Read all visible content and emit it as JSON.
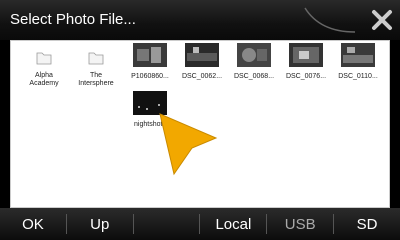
{
  "title": "Select Photo File...",
  "items": [
    {
      "type": "folder",
      "label": "Alpha\nAcademy",
      "icon": "folder-icon"
    },
    {
      "type": "folder",
      "label": "The\nIntersphere",
      "icon": "folder-icon"
    },
    {
      "type": "photo",
      "label": "P1060860..."
    },
    {
      "type": "photo",
      "label": "DSC_0062..."
    },
    {
      "type": "photo",
      "label": "DSC_0068..."
    },
    {
      "type": "photo",
      "label": "DSC_0076..."
    },
    {
      "type": "photo",
      "label": "DSC_0110..."
    },
    {
      "type": "photo",
      "label": "nightshot.j"
    }
  ],
  "buttons": {
    "ok": "OK",
    "up": "Up",
    "local": "Local",
    "usb": "USB",
    "sd": "SD"
  },
  "accent": "#f2a800"
}
